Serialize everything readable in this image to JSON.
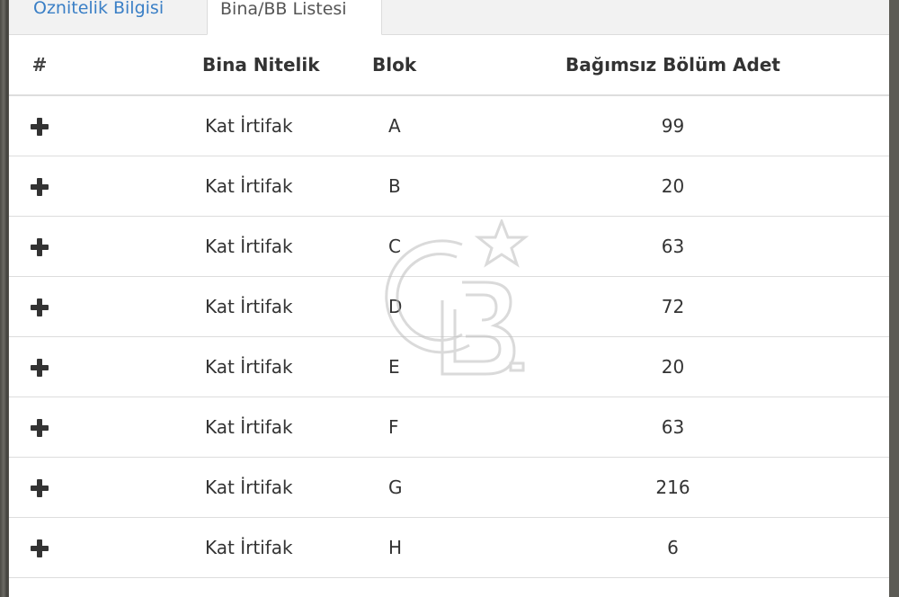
{
  "tabs": [
    {
      "label": "Öznitelik Bilgisi"
    },
    {
      "label": "Bina/BB Listesi"
    }
  ],
  "table": {
    "headers": [
      "#",
      "Bina Nitelik",
      "Blok",
      "Bağımsız Bölüm Adet"
    ],
    "rows": [
      {
        "nitelik": "Kat İrtifak",
        "blok": "A",
        "adet": "99"
      },
      {
        "nitelik": "Kat İrtifak",
        "blok": "B",
        "adet": "20"
      },
      {
        "nitelik": "Kat İrtifak",
        "blok": "C",
        "adet": "63"
      },
      {
        "nitelik": "Kat İrtifak",
        "blok": "D",
        "adet": "72"
      },
      {
        "nitelik": "Kat İrtifak",
        "blok": "E",
        "adet": "20"
      },
      {
        "nitelik": "Kat İrtifak",
        "blok": "F",
        "adet": "63"
      },
      {
        "nitelik": "Kat İrtifak",
        "blok": "G",
        "adet": "216"
      },
      {
        "nitelik": "Kat İrtifak",
        "blok": "H",
        "adet": "6"
      }
    ]
  },
  "icons": {
    "expand": "plus-icon",
    "watermark": "cb-logo-watermark"
  },
  "colors": {
    "active_tab_text": "#555555",
    "inactive_tab_text": "#3a7fc6",
    "border": "#dddddd"
  }
}
